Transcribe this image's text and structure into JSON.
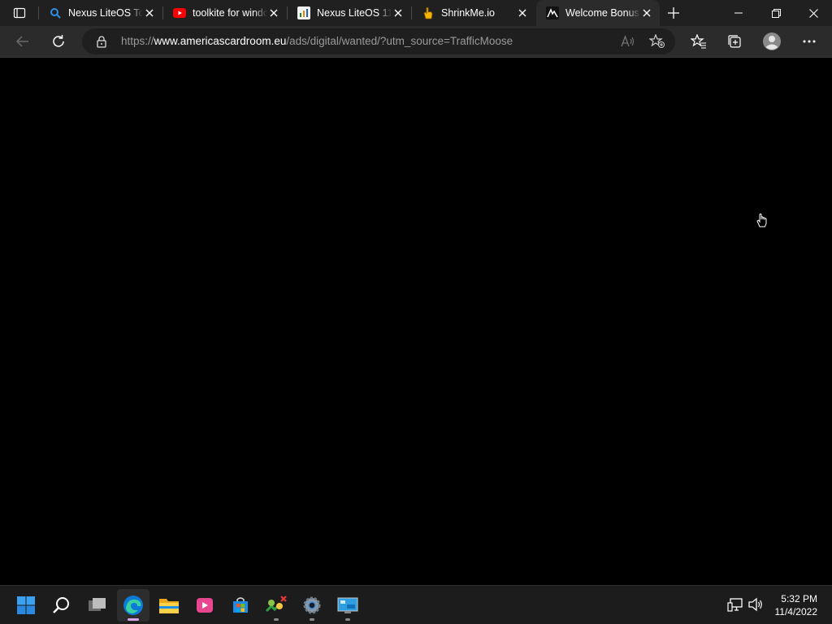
{
  "browser": {
    "tabs": [
      {
        "title": "Nexus LiteOS To",
        "favicon": "search-favicon"
      },
      {
        "title": "toolkite for windo",
        "favicon": "youtube-favicon"
      },
      {
        "title": "Nexus LiteOS 11",
        "favicon": "site-favicon"
      },
      {
        "title": "ShrinkMe.io",
        "favicon": "hand-favicon"
      },
      {
        "title": "Welcome Bonus",
        "favicon": "acr-favicon",
        "active": true
      }
    ],
    "address": {
      "prefix": "https://",
      "domain": "www.americascardroom.eu",
      "path": "/ads/digital/wanted/?utm_source=TrafficMoose"
    }
  },
  "taskbar": {
    "apps": [
      "start-icon",
      "search-icon",
      "task-view-icon",
      "edge-icon",
      "file-explorer-icon",
      "media-player-icon",
      "store-icon",
      "network-tool-icon",
      "settings-icon",
      "control-panel-icon"
    ],
    "active_app": "edge-icon"
  },
  "clock": {
    "time": "5:32 PM",
    "date": "11/4/2022"
  },
  "colors": {
    "titlebar": "#202020",
    "toolbar": "#2b2b2b",
    "taskbar": "#1c1c1c",
    "accent": "#0078d4"
  }
}
